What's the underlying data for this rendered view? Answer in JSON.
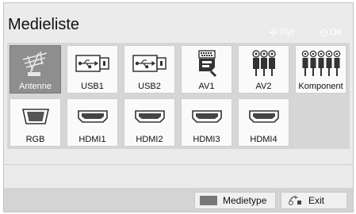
{
  "header": {
    "title": "Medieliste",
    "hint_move": "Flyt",
    "hint_ok": "OK"
  },
  "sources": [
    {
      "label": "Antenne",
      "icon": "antenna-icon",
      "selected": true
    },
    {
      "label": "USB1",
      "icon": "usb-icon"
    },
    {
      "label": "USB2",
      "icon": "usb-icon"
    },
    {
      "label": "AV1",
      "icon": "scart-icon"
    },
    {
      "label": "AV2",
      "icon": "rca-icon"
    },
    {
      "label": "Komponent",
      "icon": "component-icon"
    },
    {
      "label": "RGB",
      "icon": "vga-icon"
    },
    {
      "label": "HDMI1",
      "icon": "hdmi-icon"
    },
    {
      "label": "HDMI2",
      "icon": "hdmi-icon"
    },
    {
      "label": "HDMI3",
      "icon": "hdmi-icon"
    },
    {
      "label": "HDMI4",
      "icon": "hdmi-icon"
    }
  ],
  "footer": {
    "media_type_label": "Medietype",
    "exit_label": "Exit"
  },
  "colors": {
    "selected_tile": "#8e8e8e",
    "tile": "#fafafa",
    "background": "#ebebeb"
  }
}
